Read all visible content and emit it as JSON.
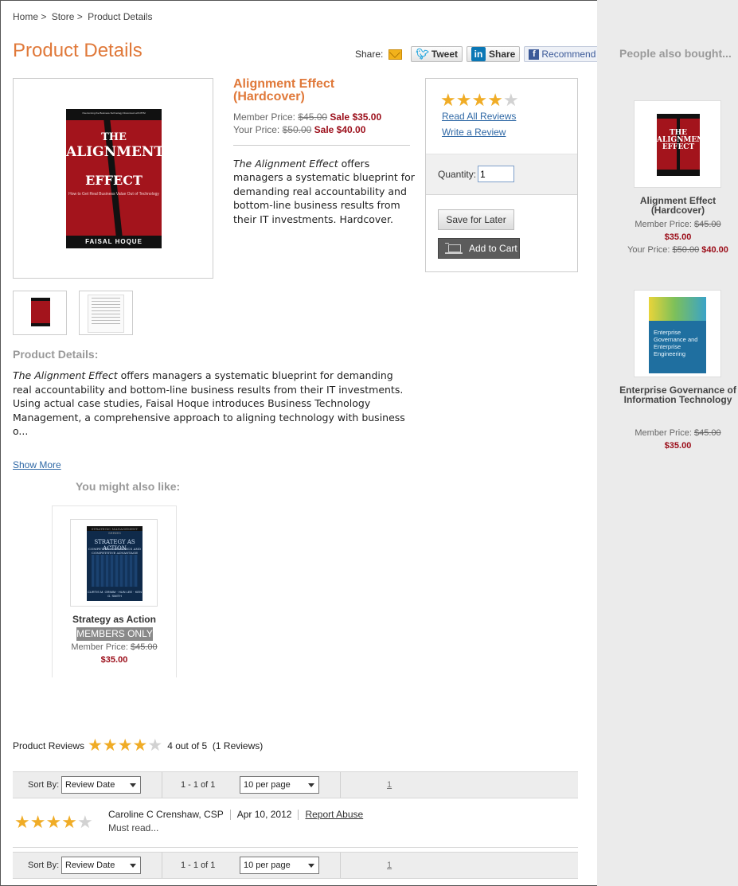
{
  "breadcrumb": [
    "Home >",
    "Store >",
    "Product Details"
  ],
  "page_title": "Product Details",
  "share": {
    "label": "Share:",
    "tweet": "Tweet",
    "linkedin": "Share",
    "linkedin_logo": "in",
    "facebook": "Recommend",
    "facebook_logo": "f"
  },
  "product": {
    "title": "Alignment Effect (Hardcover)",
    "member_price_label": "Member Price:",
    "member_price_old": "$45.00",
    "member_price_sale": "Sale $35.00",
    "your_price_label": "Your Price:",
    "your_price_old": "$50.00",
    "your_price_sale": "Sale $40.00",
    "desc_italic": "The Alignment Effect",
    "desc_rest": " offers managers a systematic blueprint for demanding real accountability and bottom-line business results from their IT investments. Hardcover.",
    "cover": {
      "top_text": "Overcoming the Business-Technology Disconnect with BTM",
      "title_1": "THE",
      "title_2": "ALIGNMENT",
      "title_3": "EFFECT",
      "subtitle": "How to Get Real Business Value Out of Technology",
      "author": "FAISAL HOQUE"
    },
    "rating": 4
  },
  "buybox": {
    "read_reviews": "Read All Reviews",
    "write_review": "Write a Review",
    "quantity_label": "Quantity:",
    "quantity_value": "1",
    "save_for_later": "Save for Later",
    "add_to_cart": "Add to Cart"
  },
  "details": {
    "heading": "Product Details:",
    "body_italic": "The Alignment Effect",
    "body_rest": " offers managers a systematic blueprint for demanding real accountability and bottom-line business results from their IT investments. Using actual case studies, Faisal Hoque introduces Business Technology Management, a comprehensive approach to aligning technology with business o...",
    "show_more": "Show More"
  },
  "also_like": {
    "heading": "You might also like:",
    "item": {
      "title": "Strategy as Action",
      "badge": "MEMBERS ONLY",
      "member_price_label": "Member Price:",
      "member_price_old": "$45.00",
      "sale_price": "$35.00",
      "cover_title": "STRATEGY AS ACTION",
      "cover_sub": "COMPETITIVE DYNAMICS AND COMPETITIVE ADVANTAGE",
      "cover_series": "STRATEGIC MANAGEMENT SERIES",
      "cover_authors": "CURTIS M. GRIMM · HUN LEE · KEN G. SMITH"
    }
  },
  "reviews": {
    "label": "Product Reviews",
    "rating": 4,
    "summary": "4 out of 5",
    "count": "(1 Reviews)",
    "sort_label": "Sort By:",
    "sort_value": "Review Date",
    "range": "1 - 1 of 1",
    "per_page": "10 per page",
    "page": "1",
    "items": [
      {
        "rating": 4,
        "author": "Caroline C Crenshaw, CSP",
        "date": "Apr 10, 2012",
        "report": "Report Abuse",
        "text": "Must read..."
      }
    ]
  },
  "sidebar": {
    "heading": "People also bought...",
    "items": [
      {
        "title": "Alignment Effect (Hardcover)",
        "member_price_label": "Member Price:",
        "member_price_old": "$45.00",
        "sale_price": "$35.00",
        "your_price_label": "Your Price:",
        "your_price_old": "$50.00",
        "your_price_sale": "$40.00",
        "cover_title": "THE ALIGNMENT EFFECT"
      },
      {
        "title": "Enterprise Governance of Information Technology",
        "member_price_label": "Member Price:",
        "member_price_old": "$45.00",
        "sale_price": "$35.00",
        "cover_title": "Enterprise Governance and Enterprise Engineering"
      }
    ]
  },
  "colors": {
    "accent": "#e0793a",
    "sale": "#9b0d19",
    "link": "#3069a6",
    "star": "#f0ac26"
  }
}
